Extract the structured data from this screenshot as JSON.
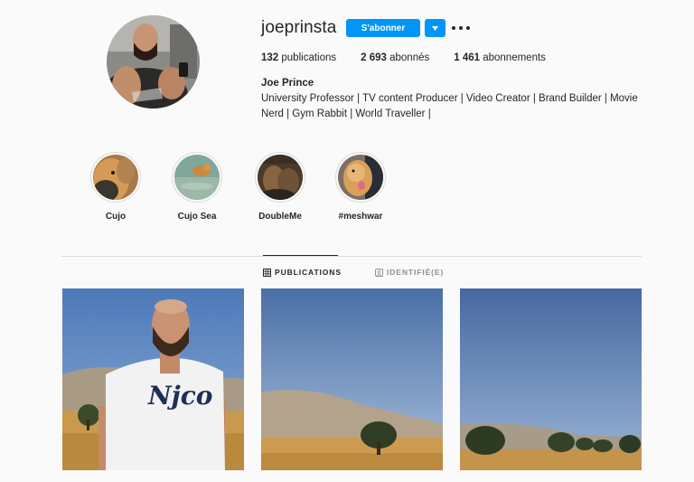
{
  "profile": {
    "username": "joeprinsta",
    "follow_label": "S'abonner",
    "full_name": "Joe Prince",
    "bio_line1": "University Professor | TV content Producer | Video Creator | Brand Builder | Movie",
    "bio_line2": "Nerd | Gym Rabbit | World Traveller |",
    "accent_color": "#0095f6"
  },
  "stats": {
    "posts_count": "132",
    "posts_label": "publications",
    "followers_count": "2 693",
    "followers_label": "abonnés",
    "following_count": "1 461",
    "following_label": "abonnements"
  },
  "highlights": [
    {
      "label": "Cujo"
    },
    {
      "label": "Cujo Sea"
    },
    {
      "label": "DoubleMe"
    },
    {
      "label": "#meshwar"
    }
  ],
  "tabs": {
    "publications": "PUBLICATIONS",
    "tagged": "IDENTIFIÉ(E)"
  },
  "icons": {
    "dropdown": "chevron-down-icon",
    "more": "more-options-icon",
    "grid": "grid-icon",
    "tagged": "tagged-user-icon"
  }
}
